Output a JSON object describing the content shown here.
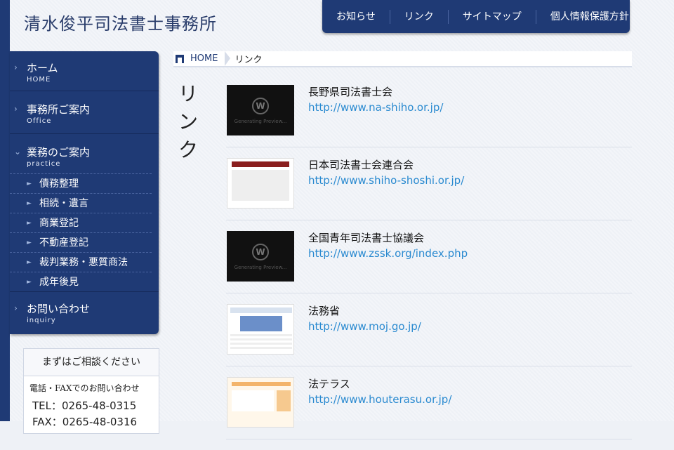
{
  "header": {
    "site_title": "清水俊平司法書士事務所",
    "nav": [
      "お知らせ",
      "リンク",
      "サイトマップ",
      "個人情報保護方針"
    ]
  },
  "sidebar": {
    "menu": [
      {
        "label": "ホーム",
        "sub": "HOME"
      },
      {
        "label": "事務所ご案内",
        "sub": "Office"
      },
      {
        "label": "業務のご案内",
        "sub": "practice"
      },
      {
        "label": "お問い合わせ",
        "sub": "inquiry"
      }
    ],
    "practice_items": [
      "債務整理",
      "相続・遺言",
      "商業登記",
      "不動産登記",
      "裁判業務・悪質商法",
      "成年後見"
    ]
  },
  "contact": {
    "heading": "まずはご相談ください",
    "note": "電話・FAXでのお問い合わせ",
    "tel": "TEL：0265-48-0315",
    "fax": "FAX：0265-48-0316"
  },
  "breadcrumb": {
    "home": "HOME",
    "current": "リンク"
  },
  "page": {
    "heading": "リンク"
  },
  "links": [
    {
      "title": "長野県司法書士会",
      "url": "http://www.na-shiho.or.jp/"
    },
    {
      "title": "日本司法書士会連合会",
      "url": "http://www.shiho-shoshi.or.jp/"
    },
    {
      "title": "全国青年司法書士協議会",
      "url": "http://www.zssk.org/index.php"
    },
    {
      "title": "法務省",
      "url": "http://www.moj.go.jp/"
    },
    {
      "title": "法テラス",
      "url": "http://www.houterasu.or.jp/"
    }
  ]
}
